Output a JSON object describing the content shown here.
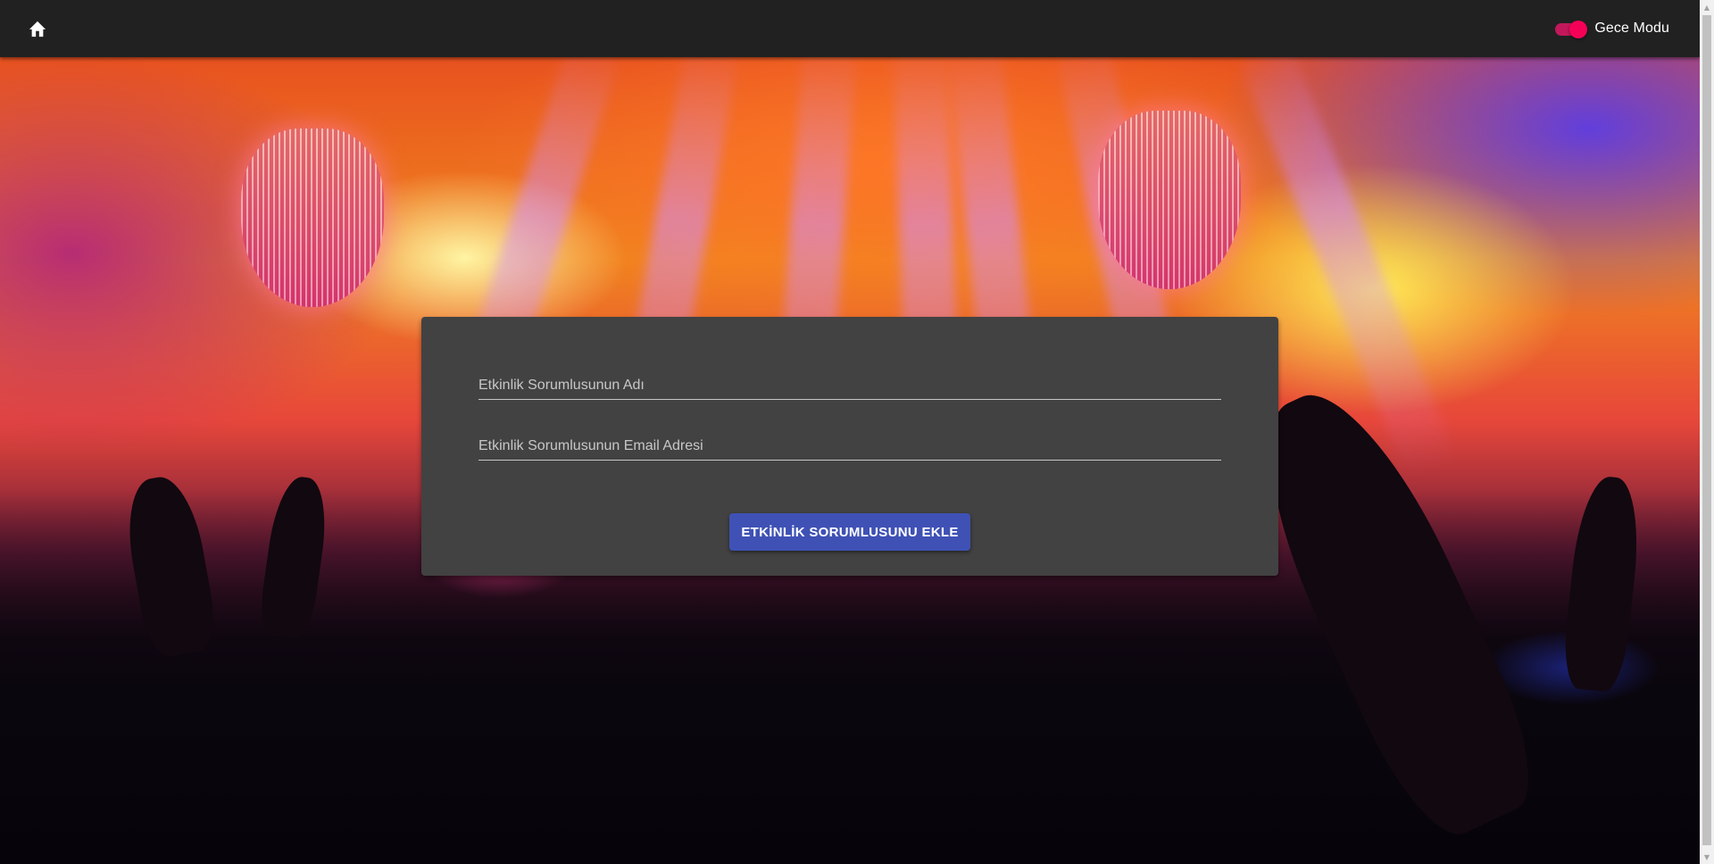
{
  "appbar": {
    "home_icon": "home-icon",
    "night_mode": {
      "label": "Gece Modu",
      "enabled": true,
      "accent_color": "#f50057"
    }
  },
  "form": {
    "organizer_name": {
      "placeholder": "Etkinlik Sorumlusunun Adı",
      "value": ""
    },
    "organizer_email": {
      "placeholder": "Etkinlik Sorumlusunun Email Adresi",
      "value": ""
    },
    "submit_label": "ETKİNLİK SORUMLUSUNU EKLE",
    "submit_color": "#3f51b5"
  }
}
